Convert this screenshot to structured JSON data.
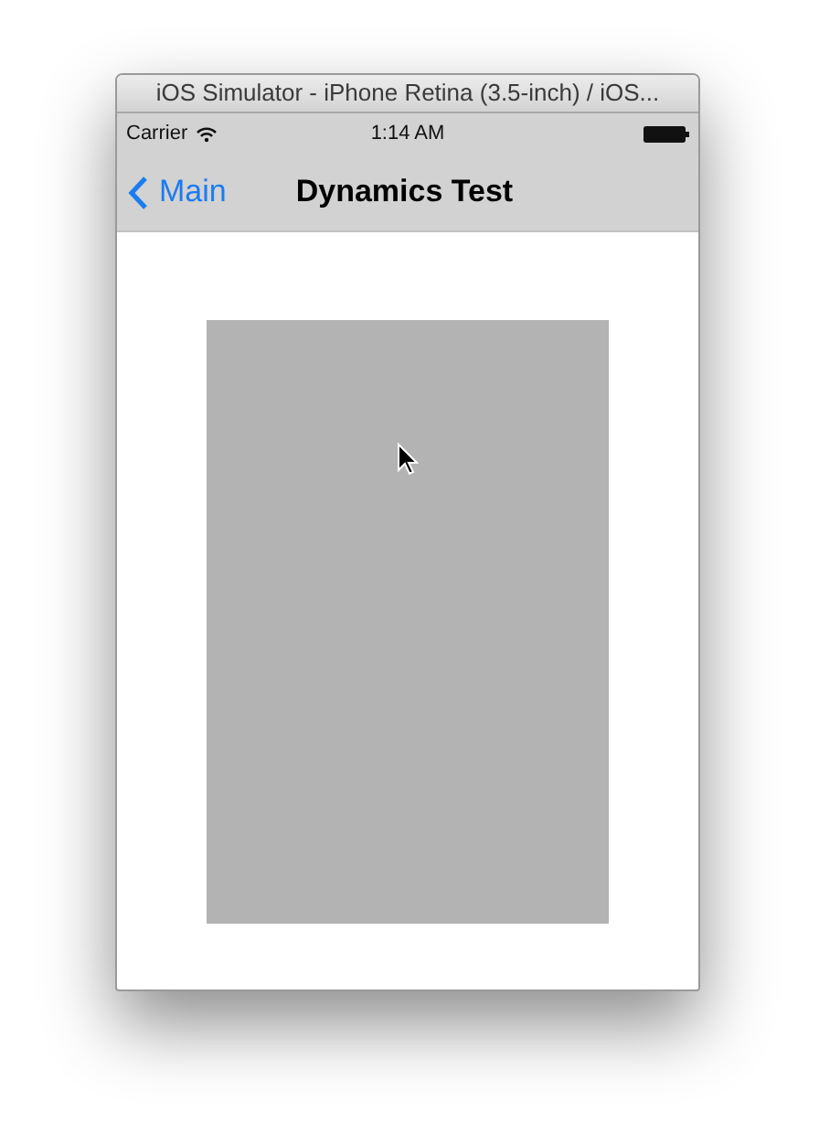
{
  "window": {
    "title": "iOS Simulator - iPhone Retina (3.5-inch) / iOS..."
  },
  "status_bar": {
    "carrier": "Carrier",
    "time": "1:14 AM"
  },
  "nav_bar": {
    "back": "Main",
    "title": "Dynamics Test"
  },
  "content": {
    "view": {
      "kind": "square-view"
    }
  }
}
